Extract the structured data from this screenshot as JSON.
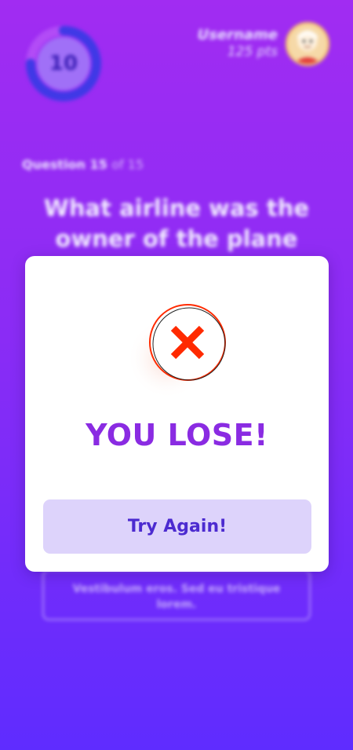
{
  "timer": {
    "value": "10",
    "progress_fraction": 0.75
  },
  "user": {
    "name": "Username",
    "points": "125 pts"
  },
  "question": {
    "counter_current": "Question 15",
    "counter_total": "of 15",
    "text": "What airline was the owner of the plane"
  },
  "answer_option": {
    "text": "Vestibulum eros. Sed eu tristique lorem."
  },
  "modal": {
    "icon": "close-x-icon",
    "title": "YOU LOSE!",
    "button_label": "Try Again!"
  },
  "colors": {
    "bg_top": "#a12cf2",
    "bg_bottom": "#5f2cff",
    "title": "#8a2be2",
    "button_bg": "#ddd3fb",
    "button_text": "#4c2bd0",
    "icon_red": "#ff2a00"
  }
}
